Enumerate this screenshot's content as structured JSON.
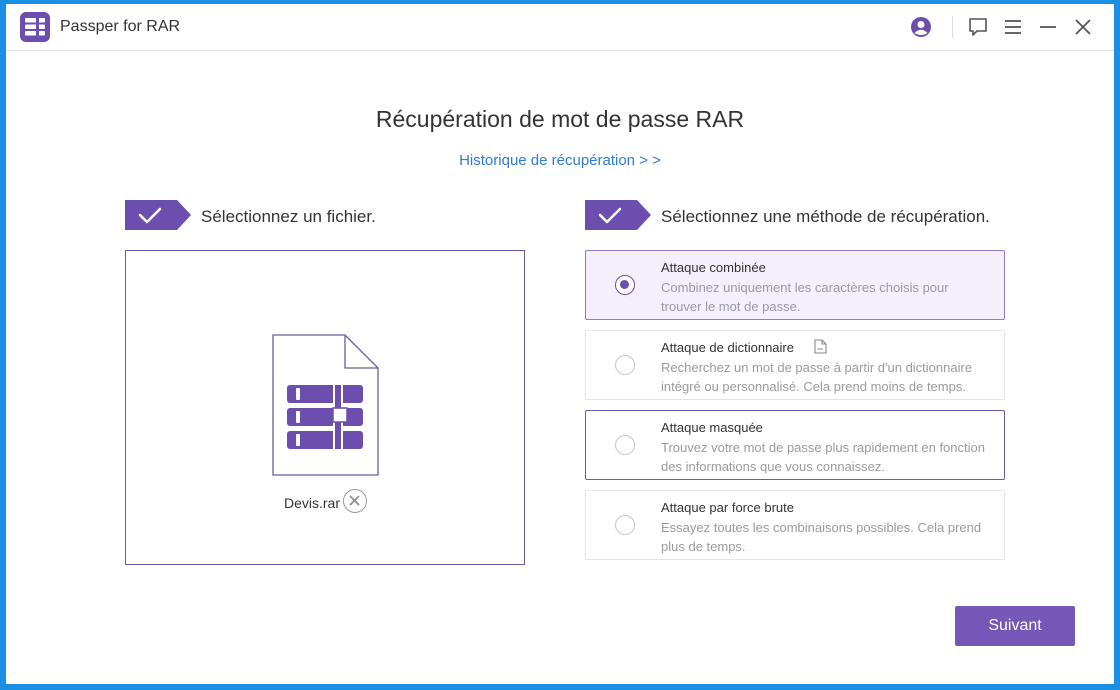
{
  "app": {
    "title": "Passper for RAR",
    "accent_color": "#6b4eae",
    "titlebar_icons": [
      "user-account-icon",
      "feedback-icon",
      "menu-icon",
      "minimize-icon",
      "close-icon"
    ]
  },
  "page": {
    "title": "Récupération de mot de passe RAR",
    "history_link": "Historique de récupération > >"
  },
  "step1": {
    "label": "Sélectionnez un fichier.",
    "file_name": "Devis.rar"
  },
  "step2": {
    "label": "Sélectionnez une méthode de récupération.",
    "methods": [
      {
        "title": "Attaque combinée",
        "description": "Combinez uniquement les caractères choisis pour trouver le mot de passe.",
        "selected": true
      },
      {
        "title": "Attaque de dictionnaire",
        "description": "Recherchez un mot de passe à partir d'un dictionnaire intégré ou personnalisé. Cela prend moins de temps.",
        "selected": false
      },
      {
        "title": "Attaque masquée",
        "description": "Trouvez votre mot de passe plus rapidement en fonction des informations que vous connaissez.",
        "selected": false
      },
      {
        "title": "Attaque par force brute",
        "description": "Essayez toutes les combinaisons possibles. Cela prend plus de temps.",
        "selected": false
      }
    ]
  },
  "next_button": "Suivant"
}
